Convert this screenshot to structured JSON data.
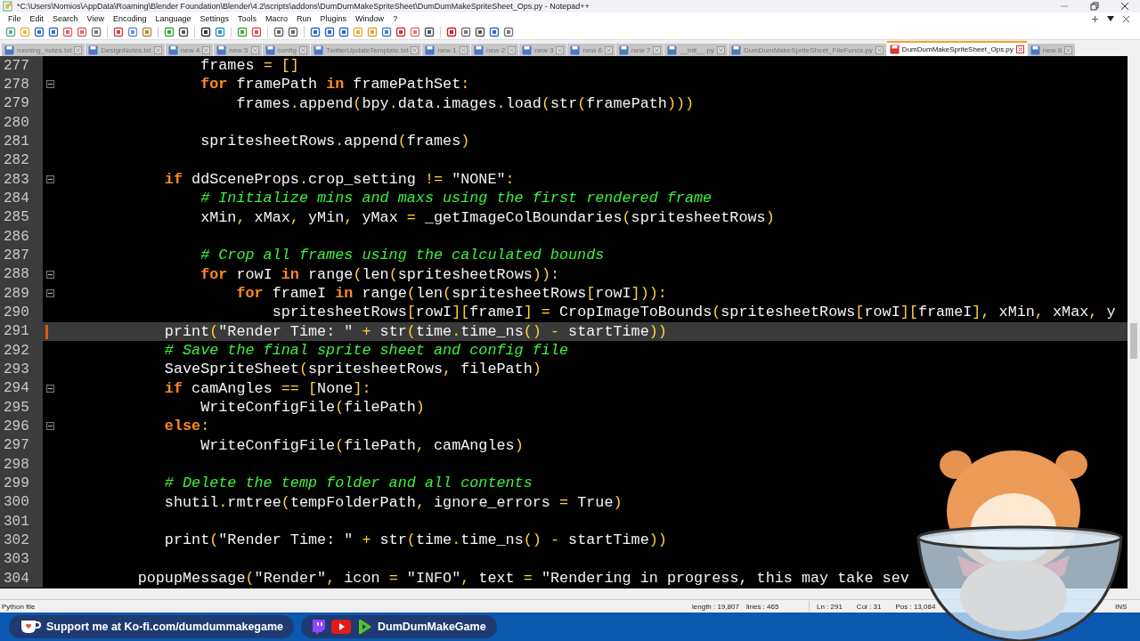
{
  "window": {
    "title": "*C:\\Users\\Nomios\\AppData\\Roaming\\Blender Foundation\\Blender\\4.2\\scripts\\addons\\DumDumMakeSpriteSheet\\DumDumMakeSpriteSheet_Ops.py - Notepad++"
  },
  "menu": [
    "File",
    "Edit",
    "Search",
    "View",
    "Encoding",
    "Language",
    "Settings",
    "Tools",
    "Macro",
    "Run",
    "Plugins",
    "Window",
    "?"
  ],
  "tabs": [
    {
      "label": "running_notes.txt",
      "selected": false,
      "unsaved": false
    },
    {
      "label": "DesignNotes.txt",
      "selected": false,
      "unsaved": false
    },
    {
      "label": "new 4",
      "selected": false,
      "unsaved": false
    },
    {
      "label": "new 5",
      "selected": false,
      "unsaved": false
    },
    {
      "label": "config",
      "selected": false,
      "unsaved": false
    },
    {
      "label": "TwitterUpdateTemplate.txt",
      "selected": false,
      "unsaved": false
    },
    {
      "label": "new 1",
      "selected": false,
      "unsaved": false
    },
    {
      "label": "new 2",
      "selected": false,
      "unsaved": false
    },
    {
      "label": "new 3",
      "selected": false,
      "unsaved": false
    },
    {
      "label": "new 6",
      "selected": false,
      "unsaved": false
    },
    {
      "label": "new 7",
      "selected": false,
      "unsaved": false
    },
    {
      "label": "__init__.py",
      "selected": false,
      "unsaved": false
    },
    {
      "label": "DumDumMakeSpriteSheet_FileFuncs.py",
      "selected": false,
      "unsaved": false
    },
    {
      "label": "DumDumMakeSpriteSheet_Ops.py",
      "selected": true,
      "unsaved": true
    },
    {
      "label": "new 8",
      "selected": false,
      "unsaved": false
    }
  ],
  "editor": {
    "lines": [
      {
        "num": "277",
        "tokens": [
          {
            "text": "                frames ",
            "kind": "plain"
          },
          {
            "text": "= []",
            "kind": "op"
          }
        ]
      },
      {
        "num": "278",
        "fold": true,
        "tokens": [
          {
            "text": "                for",
            "kind": "keyword"
          },
          {
            "text": " framePath ",
            "kind": "plain"
          },
          {
            "text": "in",
            "kind": "keyword"
          },
          {
            "text": " framePathSet",
            "kind": "plain"
          },
          {
            "text": ":",
            "kind": "op"
          }
        ]
      },
      {
        "num": "279",
        "tokens": [
          {
            "text": "                    frames",
            "kind": "plain"
          },
          {
            "text": ".",
            "kind": "op"
          },
          {
            "text": "append",
            "kind": "plain"
          },
          {
            "text": "(",
            "kind": "op"
          },
          {
            "text": "bpy",
            "kind": "plain"
          },
          {
            "text": ".",
            "kind": "op"
          },
          {
            "text": "data",
            "kind": "plain"
          },
          {
            "text": ".",
            "kind": "op"
          },
          {
            "text": "images",
            "kind": "plain"
          },
          {
            "text": ".",
            "kind": "op"
          },
          {
            "text": "load",
            "kind": "plain"
          },
          {
            "text": "(",
            "kind": "op"
          },
          {
            "text": "str",
            "kind": "plain"
          },
          {
            "text": "(",
            "kind": "op"
          },
          {
            "text": "framePath",
            "kind": "plain"
          },
          {
            "text": ")))",
            "kind": "op"
          }
        ]
      },
      {
        "num": "280"
      },
      {
        "num": "281",
        "tokens": [
          {
            "text": "                spritesheetRows",
            "kind": "plain"
          },
          {
            "text": ".",
            "kind": "op"
          },
          {
            "text": "append",
            "kind": "plain"
          },
          {
            "text": "(",
            "kind": "op"
          },
          {
            "text": "frames",
            "kind": "plain"
          },
          {
            "text": ")",
            "kind": "op"
          }
        ]
      },
      {
        "num": "282"
      },
      {
        "num": "283",
        "fold": true,
        "tokens": [
          {
            "text": "            if",
            "kind": "keyword"
          },
          {
            "text": " ddSceneProps",
            "kind": "plain"
          },
          {
            "text": ".",
            "kind": "op"
          },
          {
            "text": "crop_setting ",
            "kind": "plain"
          },
          {
            "text": "!= ",
            "kind": "op"
          },
          {
            "text": "\"NONE\"",
            "kind": "string"
          },
          {
            "text": ":",
            "kind": "op"
          }
        ]
      },
      {
        "num": "284",
        "tokens": [
          {
            "text": "                # Initialize mins and maxs using the first rendered frame",
            "kind": "comment"
          }
        ]
      },
      {
        "num": "285",
        "tokens": [
          {
            "text": "                xMin",
            "kind": "plain"
          },
          {
            "text": ",",
            "kind": "op"
          },
          {
            "text": " xMax",
            "kind": "plain"
          },
          {
            "text": ",",
            "kind": "op"
          },
          {
            "text": " yMin",
            "kind": "plain"
          },
          {
            "text": ",",
            "kind": "op"
          },
          {
            "text": " yMax ",
            "kind": "plain"
          },
          {
            "text": "=",
            "kind": "op"
          },
          {
            "text": " _getImageColBoundaries",
            "kind": "plain"
          },
          {
            "text": "(",
            "kind": "op"
          },
          {
            "text": "spritesheetRows",
            "kind": "plain"
          },
          {
            "text": ")",
            "kind": "op"
          }
        ]
      },
      {
        "num": "286"
      },
      {
        "num": "287",
        "tokens": [
          {
            "text": "                # Crop all frames using the calculated bounds",
            "kind": "comment"
          }
        ]
      },
      {
        "num": "288",
        "fold": true,
        "tokens": [
          {
            "text": "                for",
            "kind": "keyword"
          },
          {
            "text": " rowI ",
            "kind": "plain"
          },
          {
            "text": "in",
            "kind": "keyword"
          },
          {
            "text": " range",
            "kind": "plain"
          },
          {
            "text": "(",
            "kind": "op"
          },
          {
            "text": "len",
            "kind": "plain"
          },
          {
            "text": "(",
            "kind": "op"
          },
          {
            "text": "spritesheetRows",
            "kind": "plain"
          },
          {
            "text": ")):",
            "kind": "op"
          }
        ]
      },
      {
        "num": "289",
        "fold": true,
        "tokens": [
          {
            "text": "                    for",
            "kind": "keyword"
          },
          {
            "text": " frameI ",
            "kind": "plain"
          },
          {
            "text": "in",
            "kind": "keyword"
          },
          {
            "text": " range",
            "kind": "plain"
          },
          {
            "text": "(",
            "kind": "op"
          },
          {
            "text": "len",
            "kind": "plain"
          },
          {
            "text": "(",
            "kind": "op"
          },
          {
            "text": "spritesheetRows",
            "kind": "plain"
          },
          {
            "text": "[",
            "kind": "op"
          },
          {
            "text": "rowI",
            "kind": "plain"
          },
          {
            "text": "])):",
            "kind": "op"
          }
        ]
      },
      {
        "num": "290",
        "tokens": [
          {
            "text": "                        spritesheetRows",
            "kind": "plain"
          },
          {
            "text": "[",
            "kind": "op"
          },
          {
            "text": "rowI",
            "kind": "plain"
          },
          {
            "text": "][",
            "kind": "op"
          },
          {
            "text": "frameI",
            "kind": "plain"
          },
          {
            "text": "] =",
            "kind": "op"
          },
          {
            "text": " CropImageToBounds",
            "kind": "plain"
          },
          {
            "text": "(",
            "kind": "op"
          },
          {
            "text": "spritesheetRows",
            "kind": "plain"
          },
          {
            "text": "[",
            "kind": "op"
          },
          {
            "text": "rowI",
            "kind": "plain"
          },
          {
            "text": "][",
            "kind": "op"
          },
          {
            "text": "frameI",
            "kind": "plain"
          },
          {
            "text": "],",
            "kind": "op"
          },
          {
            "text": " xMin",
            "kind": "plain"
          },
          {
            "text": ",",
            "kind": "op"
          },
          {
            "text": " xMax",
            "kind": "plain"
          },
          {
            "text": ",",
            "kind": "op"
          },
          {
            "text": " y",
            "kind": "plain"
          }
        ]
      },
      {
        "num": "291",
        "current": true,
        "tokens": [
          {
            "text": "            print",
            "kind": "plain"
          },
          {
            "text": "(",
            "kind": "op"
          },
          {
            "text": "\"Render Time: \"",
            "kind": "string"
          },
          {
            "text": " +",
            "kind": "op"
          },
          {
            "text": " str",
            "kind": "plain"
          },
          {
            "text": "(",
            "kind": "op"
          },
          {
            "text": "time",
            "kind": "plain"
          },
          {
            "text": ".",
            "kind": "op"
          },
          {
            "text": "time_ns",
            "kind": "plain"
          },
          {
            "text": "() -",
            "kind": "op"
          },
          {
            "text": " startTime",
            "kind": "plain"
          },
          {
            "text": "))",
            "kind": "op"
          }
        ]
      },
      {
        "num": "292",
        "tokens": [
          {
            "text": "            # Save the final sprite sheet and config file",
            "kind": "comment"
          }
        ]
      },
      {
        "num": "293",
        "tokens": [
          {
            "text": "            SaveSpriteSheet",
            "kind": "plain"
          },
          {
            "text": "(",
            "kind": "op"
          },
          {
            "text": "spritesheetRows",
            "kind": "plain"
          },
          {
            "text": ",",
            "kind": "op"
          },
          {
            "text": " filePath",
            "kind": "plain"
          },
          {
            "text": ")",
            "kind": "op"
          }
        ]
      },
      {
        "num": "294",
        "fold": true,
        "tokens": [
          {
            "text": "            if",
            "kind": "keyword"
          },
          {
            "text": " camAngles ",
            "kind": "plain"
          },
          {
            "text": "== [",
            "kind": "op"
          },
          {
            "text": "None",
            "kind": "plain"
          },
          {
            "text": "]:",
            "kind": "op"
          }
        ]
      },
      {
        "num": "295",
        "tokens": [
          {
            "text": "                WriteConfigFile",
            "kind": "plain"
          },
          {
            "text": "(",
            "kind": "op"
          },
          {
            "text": "filePath",
            "kind": "plain"
          },
          {
            "text": ")",
            "kind": "op"
          }
        ]
      },
      {
        "num": "296",
        "fold": true,
        "tokens": [
          {
            "text": "            else",
            "kind": "keyword"
          },
          {
            "text": ":",
            "kind": "op"
          }
        ]
      },
      {
        "num": "297",
        "tokens": [
          {
            "text": "                WriteConfigFile",
            "kind": "plain"
          },
          {
            "text": "(",
            "kind": "op"
          },
          {
            "text": "filePath",
            "kind": "plain"
          },
          {
            "text": ",",
            "kind": "op"
          },
          {
            "text": " camAngles",
            "kind": "plain"
          },
          {
            "text": ")",
            "kind": "op"
          }
        ]
      },
      {
        "num": "298"
      },
      {
        "num": "299",
        "tokens": [
          {
            "text": "            # Delete the temp folder and all contents",
            "kind": "comment"
          }
        ]
      },
      {
        "num": "300",
        "tokens": [
          {
            "text": "            shutil",
            "kind": "plain"
          },
          {
            "text": ".",
            "kind": "op"
          },
          {
            "text": "rmtree",
            "kind": "plain"
          },
          {
            "text": "(",
            "kind": "op"
          },
          {
            "text": "tempFolderPath",
            "kind": "plain"
          },
          {
            "text": ",",
            "kind": "op"
          },
          {
            "text": " ignore_errors ",
            "kind": "plain"
          },
          {
            "text": "=",
            "kind": "op"
          },
          {
            "text": " True",
            "kind": "plain"
          },
          {
            "text": ")",
            "kind": "op"
          }
        ]
      },
      {
        "num": "301"
      },
      {
        "num": "302",
        "tokens": [
          {
            "text": "            print",
            "kind": "plain"
          },
          {
            "text": "(",
            "kind": "op"
          },
          {
            "text": "\"Render Time: \"",
            "kind": "string"
          },
          {
            "text": " +",
            "kind": "op"
          },
          {
            "text": " str",
            "kind": "plain"
          },
          {
            "text": "(",
            "kind": "op"
          },
          {
            "text": "time",
            "kind": "plain"
          },
          {
            "text": ".",
            "kind": "op"
          },
          {
            "text": "time_ns",
            "kind": "plain"
          },
          {
            "text": "() -",
            "kind": "op"
          },
          {
            "text": " startTime",
            "kind": "plain"
          },
          {
            "text": "))",
            "kind": "op"
          }
        ]
      },
      {
        "num": "303"
      },
      {
        "num": "304",
        "tokens": [
          {
            "text": "         popupMessage",
            "kind": "plain"
          },
          {
            "text": "(",
            "kind": "op"
          },
          {
            "text": "\"Render\"",
            "kind": "string"
          },
          {
            "text": ",",
            "kind": "op"
          },
          {
            "text": " icon ",
            "kind": "plain"
          },
          {
            "text": "= ",
            "kind": "op"
          },
          {
            "text": "\"INFO\"",
            "kind": "string"
          },
          {
            "text": ",",
            "kind": "op"
          },
          {
            "text": " text ",
            "kind": "plain"
          },
          {
            "text": "= ",
            "kind": "op"
          },
          {
            "text": "\"Rendering in progress, this may take sev",
            "kind": "string"
          }
        ]
      }
    ]
  },
  "status_bar": {
    "file_type": "Python file",
    "length": "length : 19,807",
    "lines": "lines : 465",
    "line": "Ln : 291",
    "col": "Col : 31",
    "pos": "Pos : 13,084",
    "mode": "INS"
  },
  "banner": {
    "support": "Support me at Ko-fi.com/dumdummakegame",
    "channel": "DumDumMakeGame"
  }
}
